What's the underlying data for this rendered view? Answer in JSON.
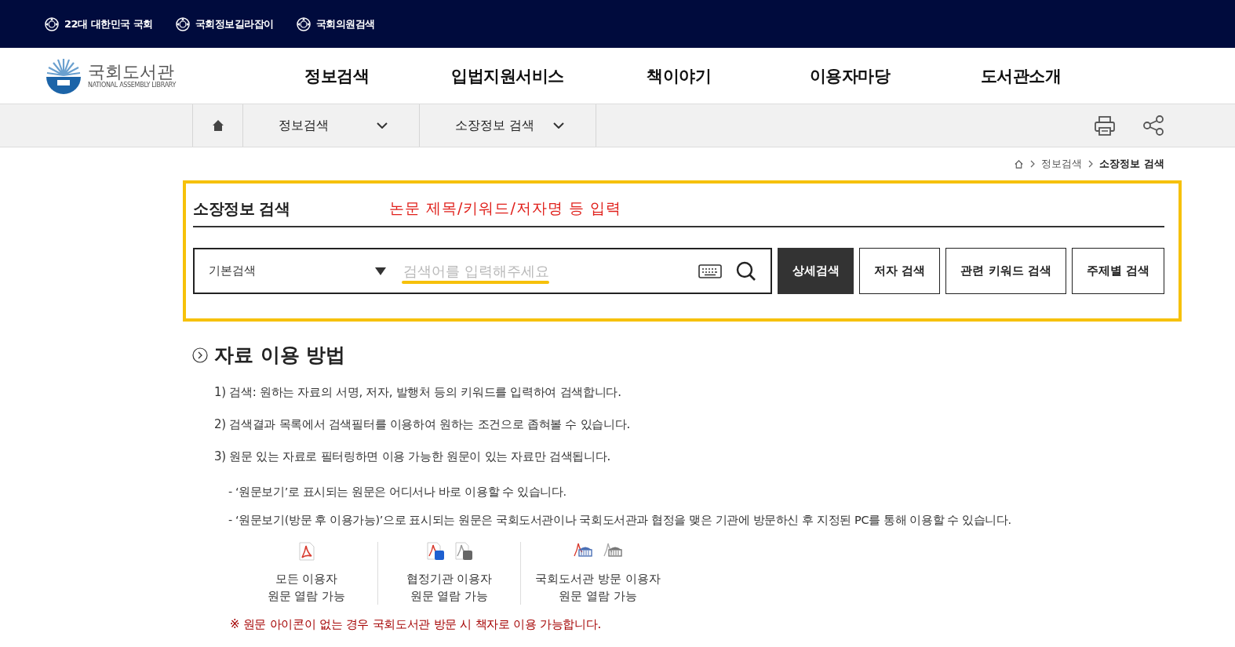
{
  "top_links": [
    "22대 대한민국 국회",
    "국회정보길라잡이",
    "국회의원검색"
  ],
  "logo": {
    "name": "국회도서관",
    "subtitle": "NATIONAL ASSEMBLY LIBRARY"
  },
  "main_nav": [
    "정보검색",
    "입법지원서비스",
    "책이야기",
    "이용자마당",
    "도서관소개"
  ],
  "location_bar": {
    "menus": [
      "정보검색",
      "소장정보 검색"
    ]
  },
  "breadcrumb": [
    {
      "label": "정보검색",
      "current": false
    },
    {
      "label": "소장정보 검색",
      "current": true
    }
  ],
  "search": {
    "title": "소장정보 검색",
    "annotation": "논문 제목/키워드/저자명 등 입력",
    "mode": "기본검색",
    "placeholder": "검색어를 입력해주세요",
    "buttons": [
      {
        "label": "상세검색",
        "primary": true
      },
      {
        "label": "저자 검색",
        "primary": false
      },
      {
        "label": "관련 키워드 검색",
        "primary": false
      },
      {
        "label": "주제별 검색",
        "primary": false
      }
    ]
  },
  "guide": {
    "title": "자료 이용 방법",
    "steps": [
      "1) 검색: 원하는 자료의 서명, 저자, 발행처 등의 키워드를 입력하여 검색합니다.",
      "2) 검색결과 목록에서 검색필터를 이용하여 원하는 조건으로 좁혀볼 수 있습니다.",
      "3) 원문 있는 자료로 필터링하면 이용 가능한 원문이 있는 자료만 검색됩니다."
    ],
    "notes": [
      "- ‘원문보기’로 표시되는 원문은 어디서나 바로 이용할 수 있습니다.",
      "- ‘원문보기(방문 후 이용가능)’으로 표시되는 원문은 국회도서관이나 국회도서관과 협정을 맺은 기관에 방문하신 후 지정된 PC를 통해 이용할 수 있습니다."
    ],
    "legend": [
      {
        "kind": "all",
        "lines": [
          "모든 이용자",
          "원문 열람 가능"
        ]
      },
      {
        "kind": "partner",
        "lines": [
          "협정기관 이용자",
          "원문 열람 가능"
        ]
      },
      {
        "kind": "visit",
        "lines": [
          "국회도서관 방문 이용자",
          "원문 열람 가능"
        ]
      }
    ],
    "warning": "※ 원문 아이콘이 없는 경우 국회도서관 방문 시 책자로 이용 가능합니다."
  }
}
